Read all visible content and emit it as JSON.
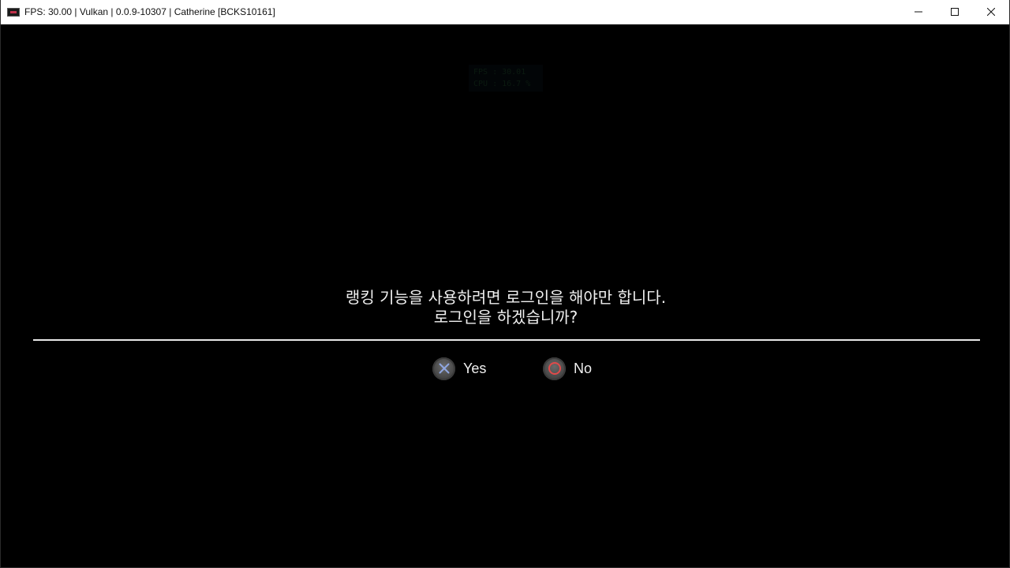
{
  "window": {
    "title": "FPS: 30.00 | Vulkan | 0.0.9-10307 | Catherine [BCKS10161]",
    "controls": {
      "minimize": "minimize-icon",
      "maximize": "maximize-icon",
      "close": "close-icon"
    }
  },
  "overlay": {
    "fps_line": "FPS : 30.01",
    "cpu_line": "CPU : 16.7 %"
  },
  "dialog": {
    "message_line1": "랭킹 기능을 사용하려면 로그인을 해야만 합니다.",
    "message_line2": "로그인을 하겠습니까?",
    "yes_label": "Yes",
    "no_label": "No",
    "yes_icon": "cross-button-icon",
    "no_icon": "circle-button-icon",
    "colors": {
      "cross": "#8fa6e0",
      "circle": "#e04a4a"
    }
  }
}
